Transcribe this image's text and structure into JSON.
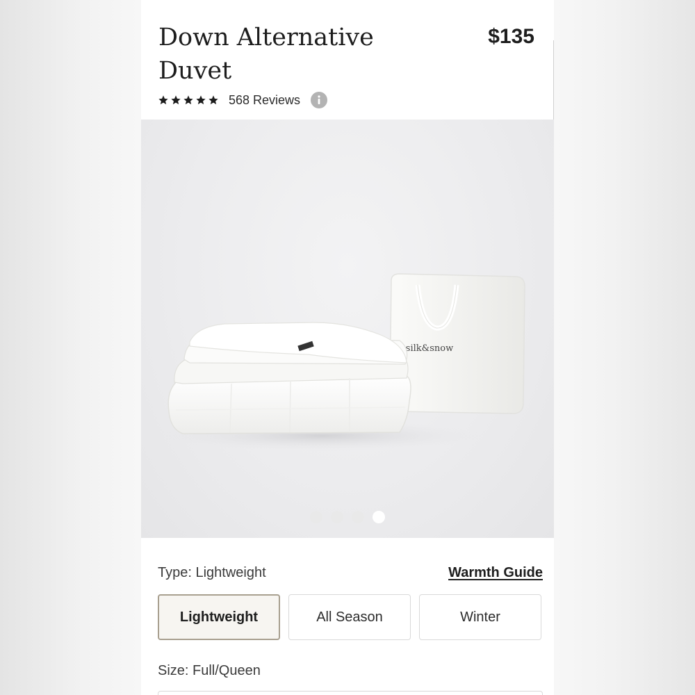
{
  "product": {
    "title": "Down Alternative Duvet",
    "price": "$135",
    "rating": {
      "stars": 5,
      "reviews_label": "568 Reviews"
    }
  },
  "hero": {
    "bag_brand_text": "silk&snow",
    "carousel": {
      "total": 4,
      "active_index": 3
    }
  },
  "type_selector": {
    "label": "Type: Lightweight",
    "guide_link": "Warmth Guide",
    "options": [
      "Lightweight",
      "All Season",
      "Winter"
    ],
    "selected": "Lightweight"
  },
  "size_selector": {
    "label": "Size: Full/Queen"
  },
  "colors": {
    "selected_border": "#a89f8f",
    "selected_bg": "#f7f5f1",
    "star": "#1d1d1d",
    "info_icon": "#b3b3b3"
  },
  "icons": {
    "star": "star-icon",
    "info": "info-icon"
  }
}
